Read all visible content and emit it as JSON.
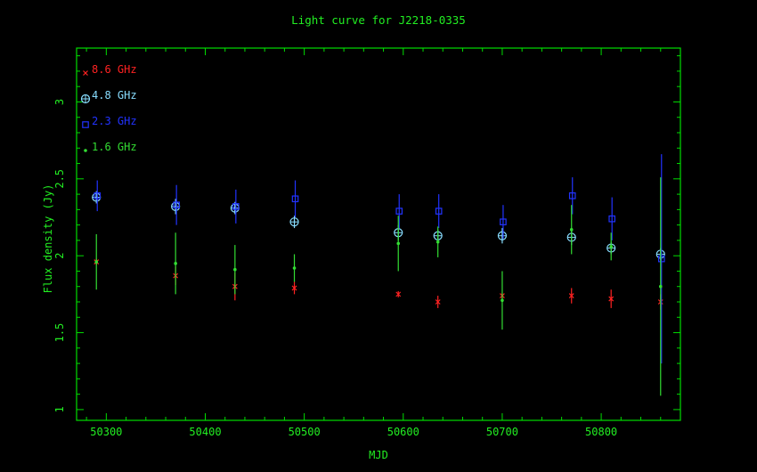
{
  "chart_data": {
    "type": "scatter",
    "title": "Light curve for J2218-0335",
    "xlabel": "MJD",
    "ylabel": "Flux density (Jy)",
    "xlim": [
      50270,
      50880
    ],
    "ylim": [
      0.93,
      3.35
    ],
    "x_ticks": [
      50300,
      50400,
      50500,
      50600,
      50700,
      50800
    ],
    "y_ticks": [
      1,
      1.5,
      2,
      2.5,
      3
    ],
    "x_tick_labels": [
      "50300",
      "50400",
      "50500",
      "50600",
      "50700",
      "50800"
    ],
    "y_tick_labels": [
      "1",
      "1.5",
      "2",
      "2.5",
      "3"
    ],
    "legend_position": "top-left",
    "axis_color": "#00dd00",
    "text_color": "#22ee22",
    "background": "#000000",
    "series": [
      {
        "name": "8.6 GHz",
        "marker": "cross",
        "color": "#ff2222",
        "points": [
          {
            "x": 50290,
            "y": 1.96,
            "err": 0.02
          },
          {
            "x": 50370,
            "y": 1.87,
            "err": 0.06
          },
          {
            "x": 50430,
            "y": 1.8,
            "err": 0.09
          },
          {
            "x": 50490,
            "y": 1.79,
            "err": 0.04
          },
          {
            "x": 50595,
            "y": 1.75,
            "err": 0.02
          },
          {
            "x": 50635,
            "y": 1.7,
            "err": 0.04
          },
          {
            "x": 50700,
            "y": 1.74,
            "err": 0.02
          },
          {
            "x": 50770,
            "y": 1.74,
            "err": 0.05
          },
          {
            "x": 50810,
            "y": 1.72,
            "err": 0.06
          },
          {
            "x": 50860,
            "y": 1.7,
            "err": 0.05
          }
        ]
      },
      {
        "name": "4.8 GHz",
        "marker": "circle-plus",
        "color": "#88ddff",
        "points": [
          {
            "x": 50290,
            "y": 2.38,
            "err": 0.04
          },
          {
            "x": 50370,
            "y": 2.32,
            "err": 0.05
          },
          {
            "x": 50430,
            "y": 2.31,
            "err": 0.04
          },
          {
            "x": 50490,
            "y": 2.22,
            "err": 0.04
          },
          {
            "x": 50595,
            "y": 2.15,
            "err": 0.05
          },
          {
            "x": 50635,
            "y": 2.13,
            "err": 0.04
          },
          {
            "x": 50700,
            "y": 2.13,
            "err": 0.05
          },
          {
            "x": 50770,
            "y": 2.12,
            "err": 0.05
          },
          {
            "x": 50810,
            "y": 2.05,
            "err": 0.04
          },
          {
            "x": 50860,
            "y": 2.01,
            "err": 0.04
          }
        ]
      },
      {
        "name": "2.3 GHz",
        "marker": "square",
        "color": "#2233ff",
        "points": [
          {
            "x": 50290,
            "y": 2.39,
            "err": 0.1
          },
          {
            "x": 50370,
            "y": 2.33,
            "err": 0.13
          },
          {
            "x": 50430,
            "y": 2.32,
            "err": 0.11
          },
          {
            "x": 50490,
            "y": 2.37,
            "err": 0.12
          },
          {
            "x": 50595,
            "y": 2.29,
            "err": 0.11
          },
          {
            "x": 50635,
            "y": 2.29,
            "err": 0.11
          },
          {
            "x": 50700,
            "y": 2.22,
            "err": 0.11
          },
          {
            "x": 50770,
            "y": 2.39,
            "err": 0.12
          },
          {
            "x": 50810,
            "y": 2.24,
            "err": 0.14
          },
          {
            "x": 50860,
            "y": 1.98,
            "err": 0.68
          }
        ]
      },
      {
        "name": "1.6 GHz",
        "marker": "dot",
        "color": "#33dd33",
        "points": [
          {
            "x": 50290,
            "y": 1.96,
            "err": 0.18
          },
          {
            "x": 50370,
            "y": 1.95,
            "err": 0.2
          },
          {
            "x": 50430,
            "y": 1.91,
            "err": 0.16
          },
          {
            "x": 50490,
            "y": 1.92,
            "err": 0.09
          },
          {
            "x": 50595,
            "y": 2.08,
            "err": 0.18
          },
          {
            "x": 50635,
            "y": 2.09,
            "err": 0.1
          },
          {
            "x": 50700,
            "y": 1.71,
            "err": 0.19
          },
          {
            "x": 50770,
            "y": 2.17,
            "err": 0.16
          },
          {
            "x": 50810,
            "y": 2.06,
            "err": 0.09
          },
          {
            "x": 50860,
            "y": 1.8,
            "err": 0.71
          }
        ]
      }
    ]
  }
}
